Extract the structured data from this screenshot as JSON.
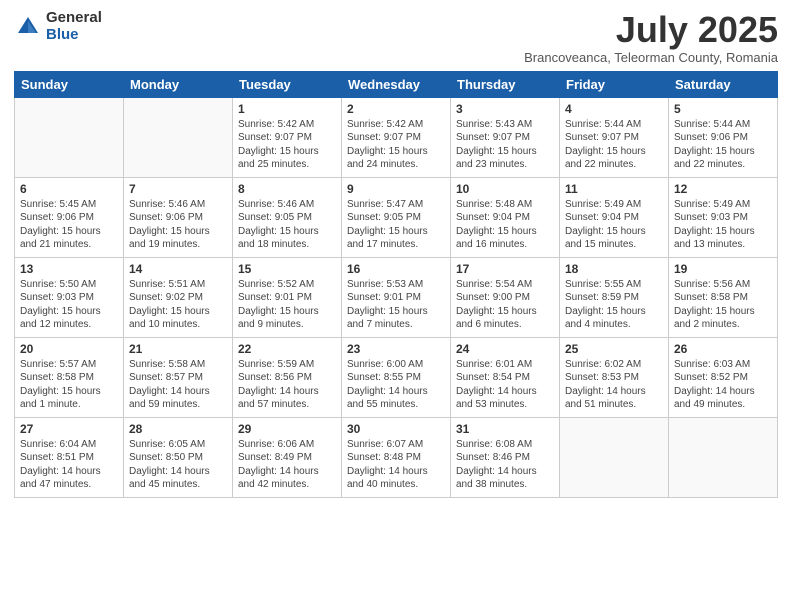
{
  "header": {
    "logo_general": "General",
    "logo_blue": "Blue",
    "month_title": "July 2025",
    "location": "Brancoveanca, Teleorman County, Romania"
  },
  "weekdays": [
    "Sunday",
    "Monday",
    "Tuesday",
    "Wednesday",
    "Thursday",
    "Friday",
    "Saturday"
  ],
  "weeks": [
    [
      {
        "day": "",
        "detail": ""
      },
      {
        "day": "",
        "detail": ""
      },
      {
        "day": "1",
        "detail": "Sunrise: 5:42 AM\nSunset: 9:07 PM\nDaylight: 15 hours\nand 25 minutes."
      },
      {
        "day": "2",
        "detail": "Sunrise: 5:42 AM\nSunset: 9:07 PM\nDaylight: 15 hours\nand 24 minutes."
      },
      {
        "day": "3",
        "detail": "Sunrise: 5:43 AM\nSunset: 9:07 PM\nDaylight: 15 hours\nand 23 minutes."
      },
      {
        "day": "4",
        "detail": "Sunrise: 5:44 AM\nSunset: 9:07 PM\nDaylight: 15 hours\nand 22 minutes."
      },
      {
        "day": "5",
        "detail": "Sunrise: 5:44 AM\nSunset: 9:06 PM\nDaylight: 15 hours\nand 22 minutes."
      }
    ],
    [
      {
        "day": "6",
        "detail": "Sunrise: 5:45 AM\nSunset: 9:06 PM\nDaylight: 15 hours\nand 21 minutes."
      },
      {
        "day": "7",
        "detail": "Sunrise: 5:46 AM\nSunset: 9:06 PM\nDaylight: 15 hours\nand 19 minutes."
      },
      {
        "day": "8",
        "detail": "Sunrise: 5:46 AM\nSunset: 9:05 PM\nDaylight: 15 hours\nand 18 minutes."
      },
      {
        "day": "9",
        "detail": "Sunrise: 5:47 AM\nSunset: 9:05 PM\nDaylight: 15 hours\nand 17 minutes."
      },
      {
        "day": "10",
        "detail": "Sunrise: 5:48 AM\nSunset: 9:04 PM\nDaylight: 15 hours\nand 16 minutes."
      },
      {
        "day": "11",
        "detail": "Sunrise: 5:49 AM\nSunset: 9:04 PM\nDaylight: 15 hours\nand 15 minutes."
      },
      {
        "day": "12",
        "detail": "Sunrise: 5:49 AM\nSunset: 9:03 PM\nDaylight: 15 hours\nand 13 minutes."
      }
    ],
    [
      {
        "day": "13",
        "detail": "Sunrise: 5:50 AM\nSunset: 9:03 PM\nDaylight: 15 hours\nand 12 minutes."
      },
      {
        "day": "14",
        "detail": "Sunrise: 5:51 AM\nSunset: 9:02 PM\nDaylight: 15 hours\nand 10 minutes."
      },
      {
        "day": "15",
        "detail": "Sunrise: 5:52 AM\nSunset: 9:01 PM\nDaylight: 15 hours\nand 9 minutes."
      },
      {
        "day": "16",
        "detail": "Sunrise: 5:53 AM\nSunset: 9:01 PM\nDaylight: 15 hours\nand 7 minutes."
      },
      {
        "day": "17",
        "detail": "Sunrise: 5:54 AM\nSunset: 9:00 PM\nDaylight: 15 hours\nand 6 minutes."
      },
      {
        "day": "18",
        "detail": "Sunrise: 5:55 AM\nSunset: 8:59 PM\nDaylight: 15 hours\nand 4 minutes."
      },
      {
        "day": "19",
        "detail": "Sunrise: 5:56 AM\nSunset: 8:58 PM\nDaylight: 15 hours\nand 2 minutes."
      }
    ],
    [
      {
        "day": "20",
        "detail": "Sunrise: 5:57 AM\nSunset: 8:58 PM\nDaylight: 15 hours\nand 1 minute."
      },
      {
        "day": "21",
        "detail": "Sunrise: 5:58 AM\nSunset: 8:57 PM\nDaylight: 14 hours\nand 59 minutes."
      },
      {
        "day": "22",
        "detail": "Sunrise: 5:59 AM\nSunset: 8:56 PM\nDaylight: 14 hours\nand 57 minutes."
      },
      {
        "day": "23",
        "detail": "Sunrise: 6:00 AM\nSunset: 8:55 PM\nDaylight: 14 hours\nand 55 minutes."
      },
      {
        "day": "24",
        "detail": "Sunrise: 6:01 AM\nSunset: 8:54 PM\nDaylight: 14 hours\nand 53 minutes."
      },
      {
        "day": "25",
        "detail": "Sunrise: 6:02 AM\nSunset: 8:53 PM\nDaylight: 14 hours\nand 51 minutes."
      },
      {
        "day": "26",
        "detail": "Sunrise: 6:03 AM\nSunset: 8:52 PM\nDaylight: 14 hours\nand 49 minutes."
      }
    ],
    [
      {
        "day": "27",
        "detail": "Sunrise: 6:04 AM\nSunset: 8:51 PM\nDaylight: 14 hours\nand 47 minutes."
      },
      {
        "day": "28",
        "detail": "Sunrise: 6:05 AM\nSunset: 8:50 PM\nDaylight: 14 hours\nand 45 minutes."
      },
      {
        "day": "29",
        "detail": "Sunrise: 6:06 AM\nSunset: 8:49 PM\nDaylight: 14 hours\nand 42 minutes."
      },
      {
        "day": "30",
        "detail": "Sunrise: 6:07 AM\nSunset: 8:48 PM\nDaylight: 14 hours\nand 40 minutes."
      },
      {
        "day": "31",
        "detail": "Sunrise: 6:08 AM\nSunset: 8:46 PM\nDaylight: 14 hours\nand 38 minutes."
      },
      {
        "day": "",
        "detail": ""
      },
      {
        "day": "",
        "detail": ""
      }
    ]
  ]
}
